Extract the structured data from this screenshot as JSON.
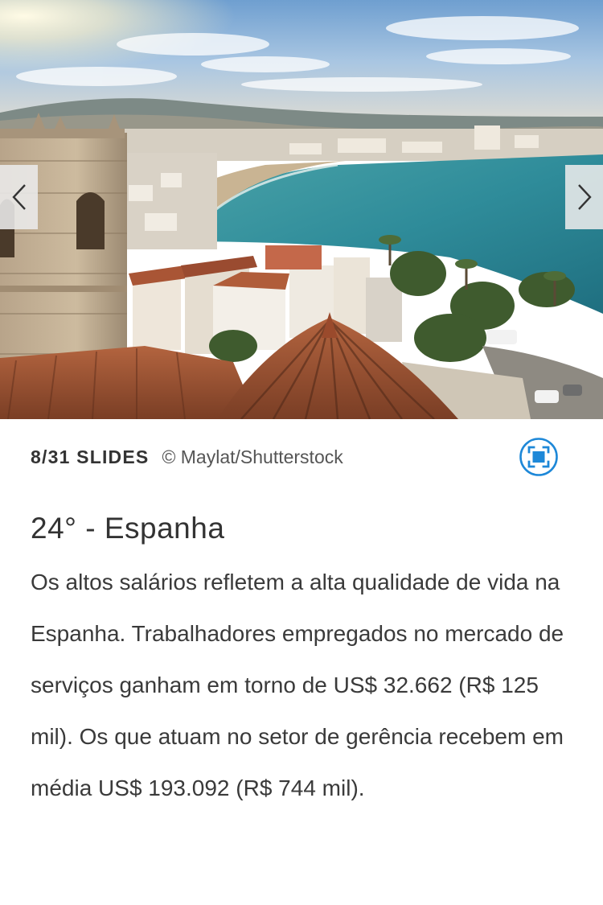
{
  "slideshow": {
    "counter": "8/31 SLIDES",
    "credit": "© Maylat/Shutterstock",
    "prev_icon": "chevron-left-icon",
    "next_icon": "chevron-right-icon",
    "fullscreen_icon": "fullscreen-icon",
    "accent_color": "#1e88d8"
  },
  "article": {
    "title": "24° - Espanha",
    "body": "Os altos salários refletem a alta qualidade de vida na Espanha. Trabalhadores empregados no mercado de serviços ganham em torno de US$ 32.662 (R$ 125 mil). Os que atuam no setor de gerência recebem em média US$ 193.092 (R$ 744 mil)."
  }
}
